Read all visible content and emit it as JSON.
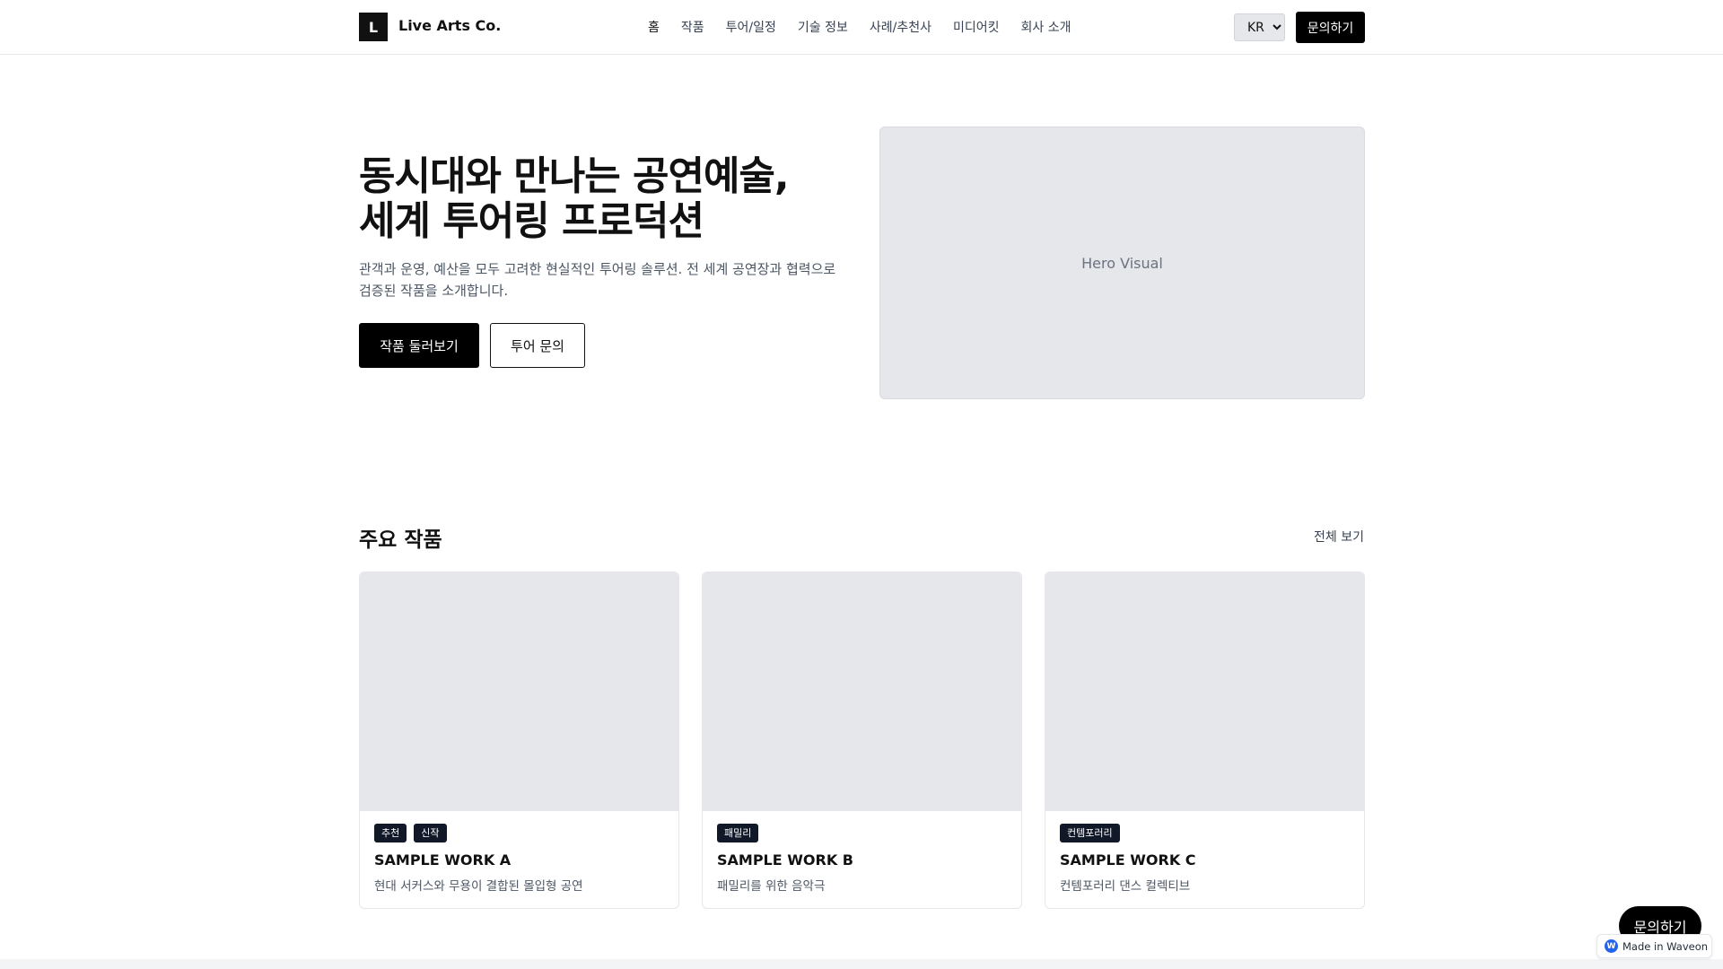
{
  "header": {
    "logo_mark": "L",
    "logo_text": "Live Arts Co.",
    "nav": [
      "홈",
      "작품",
      "투어/일정",
      "기술 정보",
      "사례/추천사",
      "미디어킷",
      "회사 소개"
    ],
    "language": "KR",
    "cta": "문의하기"
  },
  "hero": {
    "title_line1": "동시대와 만나는 공연예술,",
    "title_line2": "세계 투어링 프로덕션",
    "description": "관객과 운영, 예산을 모두 고려한 현실적인 투어링 솔루션. 전 세계 공연장과 협력으로 검증된 작품을 소개합니다.",
    "primary_button": "작품 둘러보기",
    "secondary_button": "투어 문의",
    "visual_label": "Hero Visual"
  },
  "works": {
    "title": "주요 작품",
    "view_all": "전체 보기",
    "cards": [
      {
        "tags": [
          "추천",
          "신작"
        ],
        "title": "SAMPLE WORK A",
        "subtitle": "현대 서커스와 무용이 결합된 몰입형 공연"
      },
      {
        "tags": [
          "패밀리"
        ],
        "title": "SAMPLE WORK B",
        "subtitle": "패밀리를 위한 음악극"
      },
      {
        "tags": [
          "컨템포러리"
        ],
        "title": "SAMPLE WORK C",
        "subtitle": "컨템포러리 댄스 컬렉티브"
      }
    ]
  },
  "floating": {
    "cta": "문의하기",
    "badge_icon": "W",
    "badge_text": "Made in Waveon"
  },
  "colors": {
    "primary": "#000000",
    "placeholder": "#e5e7eb",
    "tag_bg": "#111827",
    "border": "#e5e7eb"
  }
}
